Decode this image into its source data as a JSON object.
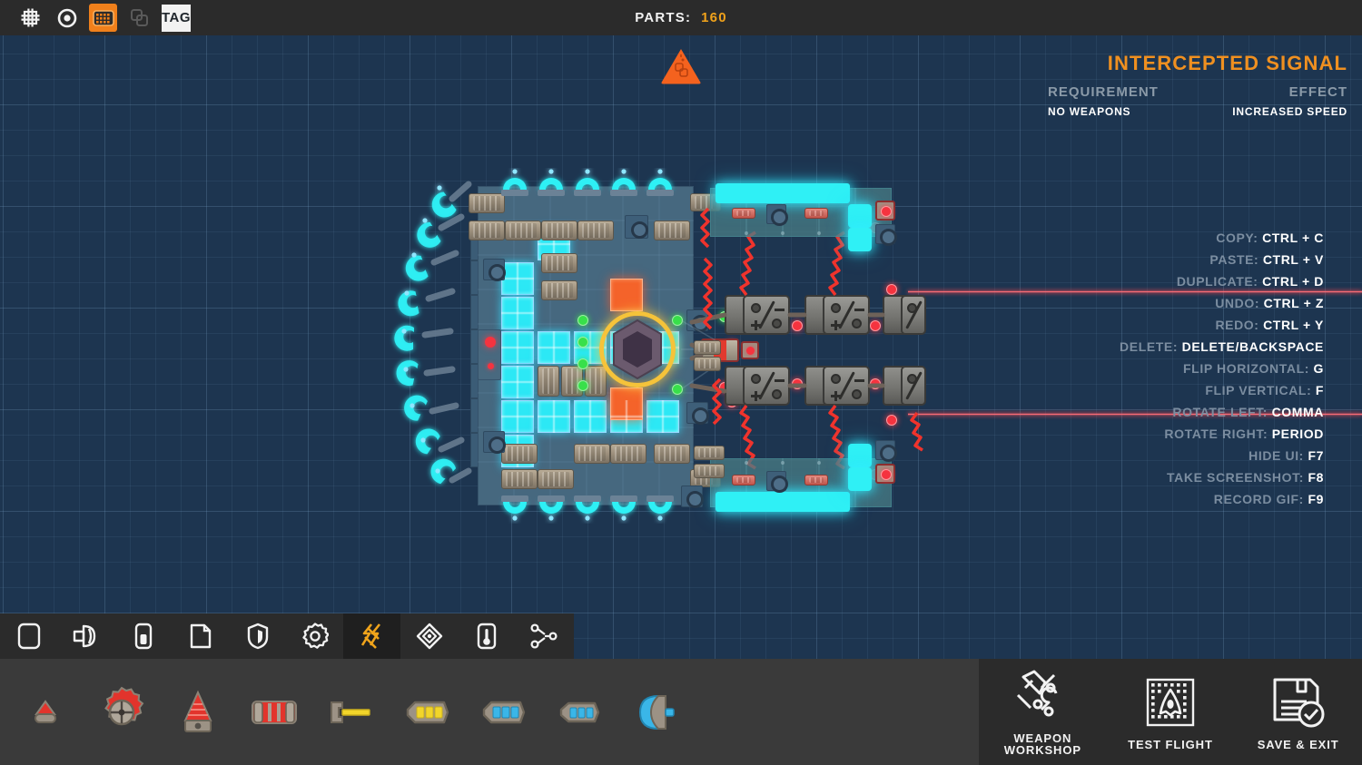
{
  "top_bar": {
    "tools": [
      {
        "name": "grid-toggle",
        "icon": "grid-icon",
        "selected": false
      },
      {
        "name": "snap-toggle",
        "icon": "circle-dot-icon",
        "selected": false
      },
      {
        "name": "fill-grid-toggle",
        "icon": "filled-grid-icon",
        "selected": true
      },
      {
        "name": "duplicate-layers-toggle",
        "icon": "layers-icon",
        "selected": false
      },
      {
        "name": "tag-button",
        "icon": "tag-icon",
        "label": "TAG",
        "selected": false
      }
    ],
    "parts_label": "PARTS:",
    "parts_value": "160"
  },
  "signal_panel": {
    "title": "INTERCEPTED SIGNAL",
    "requirement_label": "REQUIREMENT",
    "requirement_value": "NO WEAPONS",
    "effect_label": "EFFECT",
    "effect_value": "INCREASED SPEED",
    "accent_color": "#f09020"
  },
  "shortcuts": [
    {
      "key": "COPY:",
      "value": "CTRL + C"
    },
    {
      "key": "PASTE:",
      "value": "CTRL + V"
    },
    {
      "key": "DUPLICATE:",
      "value": "CTRL + D"
    },
    {
      "key": "UNDO:",
      "value": "CTRL + Z"
    },
    {
      "key": "REDO:",
      "value": "CTRL + Y"
    },
    {
      "key": "DELETE:",
      "value": "DELETE/BACKSPACE"
    },
    {
      "key": "FLIP HORIZONTAL:",
      "value": "G"
    },
    {
      "key": "FLIP VERTICAL:",
      "value": "F"
    },
    {
      "key": "ROTATE LEFT:",
      "value": "COMMA"
    },
    {
      "key": "ROTATE RIGHT:",
      "value": "PERIOD"
    },
    {
      "key": "HIDE UI:",
      "value": "F7"
    },
    {
      "key": "TAKE SCREENSHOT:",
      "value": "F8"
    },
    {
      "key": "RECORD GIF:",
      "value": "F9"
    }
  ],
  "canvas": {
    "marker_icon": "warning-blocks-icon",
    "background_color": "#1d3550",
    "grid_color": "#76a0c4",
    "laser_color": "#ff5a64"
  },
  "category_bar": [
    {
      "name": "category-hull",
      "icon": "block-icon",
      "selected": false
    },
    {
      "name": "category-thruster",
      "icon": "thruster-icon",
      "selected": false
    },
    {
      "name": "category-battery",
      "icon": "battery-icon",
      "selected": false
    },
    {
      "name": "category-cargo",
      "icon": "cargo-box-icon",
      "selected": false
    },
    {
      "name": "category-shield",
      "icon": "shield-icon",
      "selected": false
    },
    {
      "name": "category-utility",
      "icon": "gear-icon",
      "selected": false
    },
    {
      "name": "category-weapons",
      "icon": "lightning-bolts-icon",
      "selected": true
    },
    {
      "name": "category-special",
      "icon": "diamond-icon",
      "selected": false
    },
    {
      "name": "category-sensor",
      "icon": "thermometer-icon",
      "selected": false
    },
    {
      "name": "category-logic",
      "icon": "node-graph-icon",
      "selected": false
    }
  ],
  "palette": [
    {
      "name": "part-spike-mine",
      "icon": "red-cone-small-icon"
    },
    {
      "name": "part-turret",
      "icon": "red-gear-target-icon"
    },
    {
      "name": "part-drill",
      "icon": "red-cone-drill-icon"
    },
    {
      "name": "part-explosive",
      "icon": "red-barrel-icon"
    },
    {
      "name": "part-laser-emitter",
      "icon": "yellow-laser-icon"
    },
    {
      "name": "part-yellow-cell",
      "icon": "yellow-cell-icon"
    },
    {
      "name": "part-blue-cell-a",
      "icon": "blue-cell-icon"
    },
    {
      "name": "part-blue-cell-b",
      "icon": "blue-cell-small-icon"
    },
    {
      "name": "part-shield-emitter",
      "icon": "blue-shield-emitter-icon"
    }
  ],
  "actions": [
    {
      "name": "weapon-workshop-button",
      "label": "WEAPON WORKSHOP",
      "icon": "hammer-wrench-icon"
    },
    {
      "name": "test-flight-button",
      "label": "TEST FLIGHT",
      "icon": "rocket-grid-icon"
    },
    {
      "name": "save-exit-button",
      "label": "SAVE & EXIT",
      "icon": "floppy-check-icon"
    }
  ]
}
